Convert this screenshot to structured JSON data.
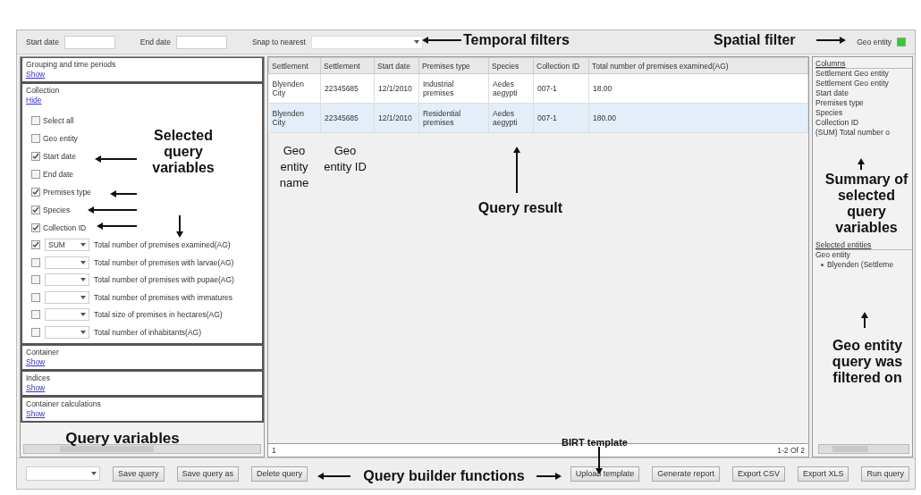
{
  "filters": {
    "start_date_label": "Start date",
    "end_date_label": "End date",
    "snap_label": "Snap to nearest",
    "spatial_label": "Geo entity",
    "spatial_on": true
  },
  "sections": [
    {
      "title": "Grouping and time periods",
      "toggle": "Show"
    },
    {
      "title": "Collection",
      "toggle": "Hide",
      "variables": [
        {
          "label": "Select all",
          "checked": false
        },
        {
          "label": "Geo entity",
          "checked": false
        },
        {
          "label": "Start date",
          "checked": true
        },
        {
          "label": "End date",
          "checked": false
        },
        {
          "label": "Premises type",
          "checked": true
        },
        {
          "label": "Species",
          "checked": true
        },
        {
          "label": "Collection ID",
          "checked": true
        }
      ],
      "measures": [
        {
          "checked": true,
          "aggregate": "SUM",
          "label": "Total number of premises examined(AG)"
        },
        {
          "checked": false,
          "label": "Total number of premises with larvae(AG)"
        },
        {
          "checked": false,
          "label": "Total number of premises with pupae(AG)"
        },
        {
          "checked": false,
          "label": "Total number of premises with immatures"
        },
        {
          "checked": false,
          "label": "Total size of premises in hectares(AG)"
        },
        {
          "checked": false,
          "label": "Total number of inhabitants(AG)"
        }
      ]
    },
    {
      "title": "Container",
      "toggle": "Show"
    },
    {
      "title": "Indices",
      "toggle": "Show"
    },
    {
      "title": "Container calculations",
      "toggle": "Show"
    }
  ],
  "table": {
    "columns": [
      "Settlement",
      "Settlement",
      "Start date",
      "Premises type",
      "Species",
      "Collection ID",
      "Total number of premises examined(AG)"
    ],
    "rows": [
      {
        "selected": false,
        "cells": [
          "Blyenden City",
          "22345685",
          "12/1/2010",
          "Industrial premises",
          "Aedes aegypti",
          "007-1",
          "18.00"
        ]
      },
      {
        "selected": true,
        "cells": [
          "Blyenden City",
          "22345685",
          "12/1/2010",
          "Residential premises",
          "Aedes aegypti",
          "007-1",
          "180.00"
        ]
      }
    ],
    "page": "1",
    "range": "1-2 Of 2"
  },
  "summary": {
    "columns_title": "Columns",
    "columns": [
      "Settlement Geo entity",
      "Settlement Geo entity",
      "Start date",
      "Premises type",
      "Species",
      "Collection ID",
      "(SUM) Total number o"
    ],
    "entities_title": "Selected entities",
    "entity_type": "Geo entity",
    "entities": [
      "Blyenden (Settleme"
    ]
  },
  "query_buttons": [
    "Save query",
    "Save query as",
    "Delete query"
  ],
  "report_buttons": [
    "Upload template",
    "Generate report",
    "Export CSV",
    "Export XLS",
    "Run query"
  ],
  "annotations": [
    "Temporal filters",
    "Spatial filter",
    "Selected query variables",
    "Geo entity name",
    "Geo entity ID",
    "Query result",
    "Summary of selected query variables",
    "Geo entity query was filtered on",
    "Query variables",
    "BIRT template",
    "Query builder functions"
  ]
}
